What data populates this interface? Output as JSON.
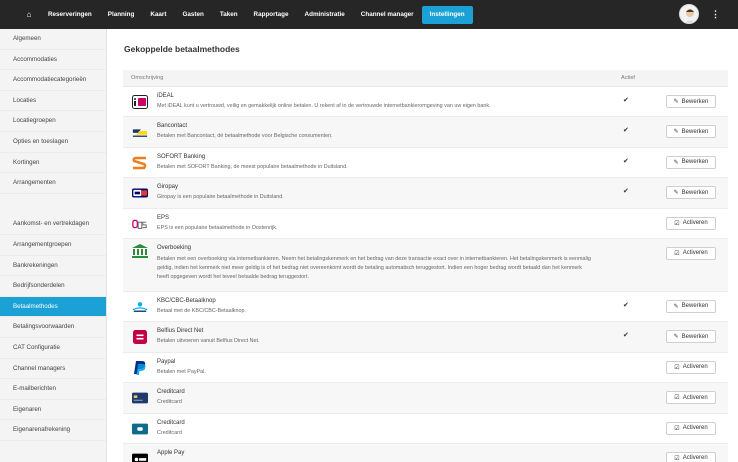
{
  "nav": {
    "home_icon": "home-icon",
    "items": [
      "Reserveringen",
      "Planning",
      "Kaart",
      "Gasten",
      "Taken",
      "Rapportage",
      "Administratie",
      "Channel manager",
      "Instellingen"
    ],
    "active": "Instellingen",
    "accent": "#1ba1d6"
  },
  "sidebar": {
    "items": [
      "Algemeen",
      "Accommodaties",
      "Accommodatiecategorieën",
      "Locaties",
      "Locatiegroepen",
      "Opties en toeslagen",
      "Kortingen",
      "Arrangementen",
      "Aankomst- en vertrekdagen",
      "Arrangementgroepen",
      "Bankrekeningen",
      "Bedrijfsonderdelen",
      "Betaalmethodes",
      "Betalingsvoorwaarden",
      "CAT Configuratie",
      "Channel managers",
      "E-mailberichten",
      "Eigenaren",
      "Eigenarenafrekening"
    ],
    "active": "Betaalmethodes"
  },
  "main": {
    "title": "Gekoppelde betaalmethodes",
    "col_description": "Omschrijving",
    "col_active": "Actief",
    "edit_label": "Bewerken",
    "activate_label": "Activeren",
    "check_mark": "✔",
    "rows": [
      {
        "title": "iDEAL",
        "desc": "Met iDEAL kunt u vertrouwd, veilig en gemakkelijk online betalen. U rekent af in de vertrouwde internetbankieromgeving van uw eigen bank.",
        "active": true,
        "logo": "ideal-logo"
      },
      {
        "title": "Bancontact",
        "desc": "Betalen met Bancontact, dé betaalmethode voor Belgische consumenten.",
        "active": true,
        "logo": "bancontact-logo"
      },
      {
        "title": "SOFORT Banking",
        "desc": "Betalen met SOFORT Banking, de meest populaire betaalmethode in Duitsland.",
        "active": true,
        "logo": "sofort-logo"
      },
      {
        "title": "Giropay",
        "desc": "Giropay is een populaire betaalmethode in Duitsland.",
        "active": true,
        "logo": "giropay-logo"
      },
      {
        "title": "EPS",
        "desc": "EPS is een populaire betaalmethode in Oostenrijk.",
        "active": false,
        "logo": "eps-logo"
      },
      {
        "title": "Overboeking",
        "desc": "Betalen met een overboeking via internetbankieren. Neem het betalingskenmerk en het bedrag van deze transactie exact over in internetbankieren. Het betalingskenmerk is eenmalig geldig, indien het kenmerk niet meer geldig is of het bedrag niet overeenkomt wordt de betaling automatisch teruggestort. Indien een hoger bedrag wordt betaald dan het kenmerk heeft opgegeven wordt het teveel betaalde bedrag teruggestort.",
        "active": false,
        "logo": "bank-logo"
      },
      {
        "title": "KBC/CBC-Betaalknop",
        "desc": "Betaal met de KBC/CBC-Betaalknop.",
        "active": true,
        "logo": "kbc-logo"
      },
      {
        "title": "Belfius Direct Net",
        "desc": "Betalen uitvoeren vanuit Belfius Direct Net.",
        "active": true,
        "logo": "belfius-logo"
      },
      {
        "title": "Paypal",
        "desc": "Betalen met PayPal.",
        "active": false,
        "logo": "paypal-logo"
      },
      {
        "title": "Creditcard",
        "desc": "Creditcard",
        "active": false,
        "logo": "creditcard-logo"
      },
      {
        "title": "Creditcard",
        "desc": "Creditcard",
        "active": false,
        "logo": "creditcard-logo"
      },
      {
        "title": "Apple Pay",
        "desc": "",
        "active": false,
        "logo": "applepay-logo"
      }
    ]
  }
}
